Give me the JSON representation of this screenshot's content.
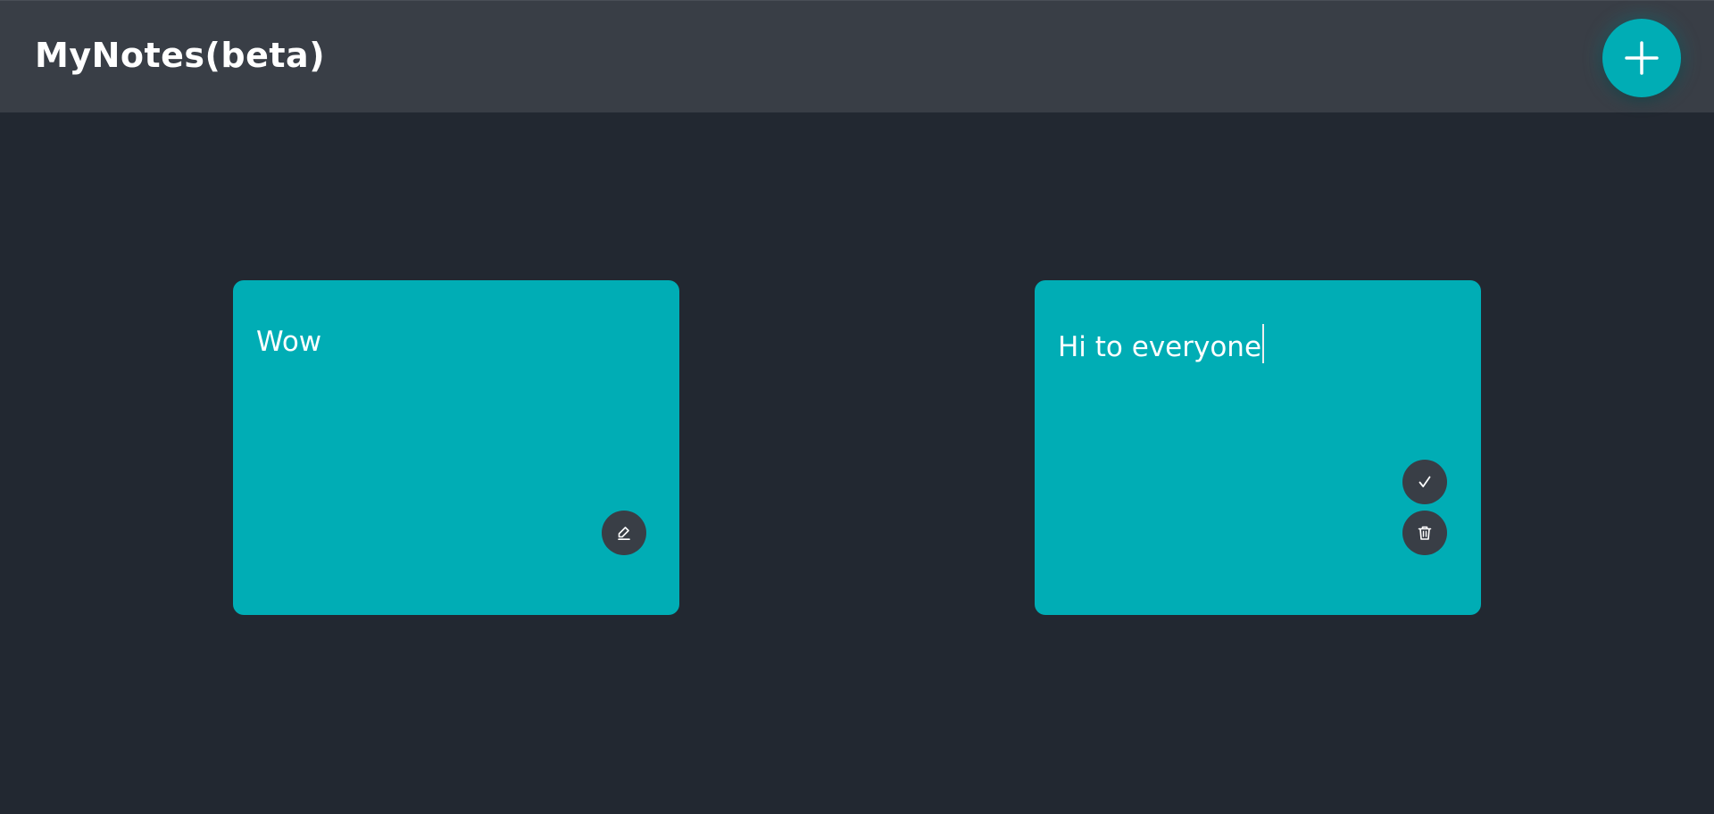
{
  "header": {
    "title": "MyNotes(beta)",
    "add_icon": "plus-icon"
  },
  "notes": [
    {
      "text": "Wow",
      "mode": "view",
      "actions": [
        "pencil-icon"
      ]
    },
    {
      "text": "Hi to everyone",
      "mode": "editing",
      "actions": [
        "checkmark-icon",
        "trash-icon"
      ]
    }
  ],
  "colors": {
    "background": "#222831",
    "header": "#393e46",
    "accent": "#00adb5",
    "button": "#393e46",
    "text": "#ffffff"
  }
}
